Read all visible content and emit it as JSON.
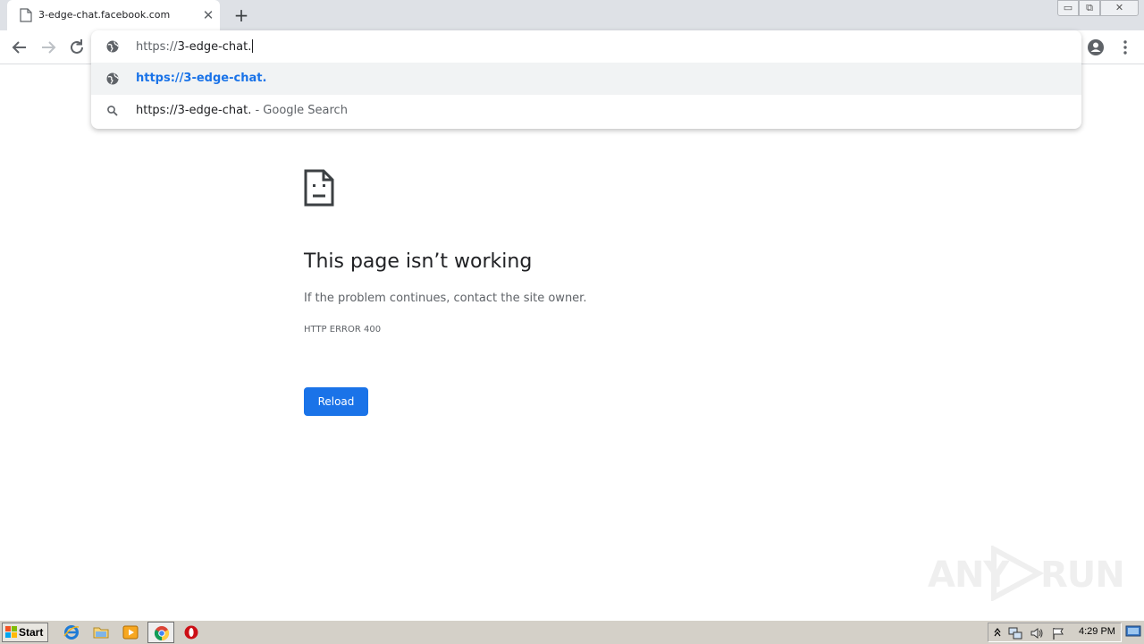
{
  "browser": {
    "tab": {
      "title": "3-edge-chat.facebook.com",
      "close_symbol": "✕"
    },
    "new_tab_symbol": "+",
    "window_controls": {
      "minimize": "▭",
      "maximize": "⧉",
      "close": "✕"
    }
  },
  "omnibox": {
    "scheme": "https://",
    "typed_text": "3-edge-chat.",
    "suggestions": [
      {
        "icon": "globe-icon",
        "text": "https://3-edge-chat.",
        "selected": true
      },
      {
        "icon": "search-icon",
        "text": "https://3-edge-chat.",
        "suffix": " - Google Search",
        "selected": false
      }
    ]
  },
  "error_page": {
    "title": "This page isn’t working",
    "message": "If the problem continues, contact the site owner.",
    "code": "HTTP ERROR 400",
    "reload_label": "Reload"
  },
  "watermark": {
    "left": "ANY",
    "right": "RUN"
  },
  "taskbar": {
    "start_label": "Start",
    "clock": "4:29 PM",
    "pinned": [
      "internet-explorer-icon",
      "folder-icon",
      "media-player-icon",
      "chrome-icon",
      "opera-icon"
    ],
    "tray_icons": [
      "arrow-up-icon",
      "network-icon",
      "speaker-icon",
      "flag-icon"
    ]
  },
  "colors": {
    "accent": "#1a73e8",
    "tabstrip": "#dee1e6",
    "taskbar": "#d4d0c8"
  }
}
